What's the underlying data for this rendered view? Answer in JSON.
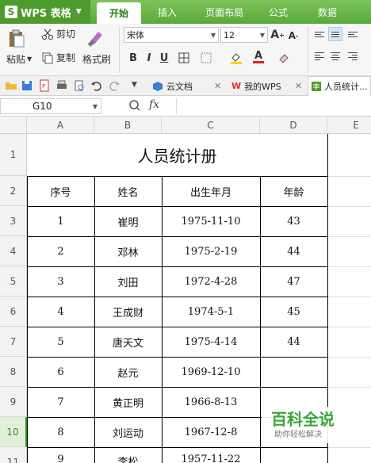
{
  "app": {
    "name": "WPS 表格",
    "logo_letter": "S"
  },
  "menu": [
    {
      "label": "开始",
      "active": true
    },
    {
      "label": "插入",
      "active": false
    },
    {
      "label": "页面布局",
      "active": false
    },
    {
      "label": "公式",
      "active": false
    },
    {
      "label": "数据",
      "active": false
    }
  ],
  "ribbon": {
    "paste": "粘贴",
    "cut": "剪切",
    "copy": "复制",
    "format_painter": "格式刷",
    "font_name": "宋体",
    "font_size": "12",
    "bold": "B",
    "italic": "I",
    "underline": "U",
    "font_color_letter": "A",
    "grow_font": "A",
    "shrink_font": "A"
  },
  "doc_tabs": [
    {
      "label": "云文档",
      "active": false,
      "closable": true
    },
    {
      "label": "我的WPS",
      "active": false,
      "closable": true
    },
    {
      "label": "人员统计...",
      "active": true,
      "closable": false
    }
  ],
  "formula_bar": {
    "cell_ref": "G10",
    "fx": "fx",
    "value": ""
  },
  "columns": [
    "A",
    "B",
    "C",
    "D",
    "E"
  ],
  "rows": [
    "1",
    "2",
    "3",
    "4",
    "5",
    "6",
    "7",
    "8",
    "9",
    "10",
    "11"
  ],
  "selected_row": "10",
  "sheet": {
    "title": "人员统计册",
    "headers": [
      "序号",
      "姓名",
      "出生年月",
      "年龄"
    ],
    "records": [
      [
        "1",
        "崔明",
        "1975-11-10",
        "43"
      ],
      [
        "2",
        "邓林",
        "1975-2-19",
        "44"
      ],
      [
        "3",
        "刘田",
        "1972-4-28",
        "47"
      ],
      [
        "4",
        "王成财",
        "1974-5-1",
        "45"
      ],
      [
        "5",
        "唐天文",
        "1975-4-14",
        "44"
      ],
      [
        "6",
        "赵元",
        "1969-12-10",
        ""
      ],
      [
        "7",
        "黄正明",
        "1966-8-13",
        ""
      ],
      [
        "8",
        "刘运动",
        "1967-12-8",
        ""
      ],
      [
        "9",
        "李松",
        "1957-11-22",
        ""
      ]
    ]
  },
  "watermark": {
    "title": "百科全说",
    "subtitle": "助你轻松解决"
  },
  "colors": {
    "brand_green": "#5aa83a",
    "active_tab_text": "#2a7a12",
    "selection": "#3a8a1a"
  }
}
